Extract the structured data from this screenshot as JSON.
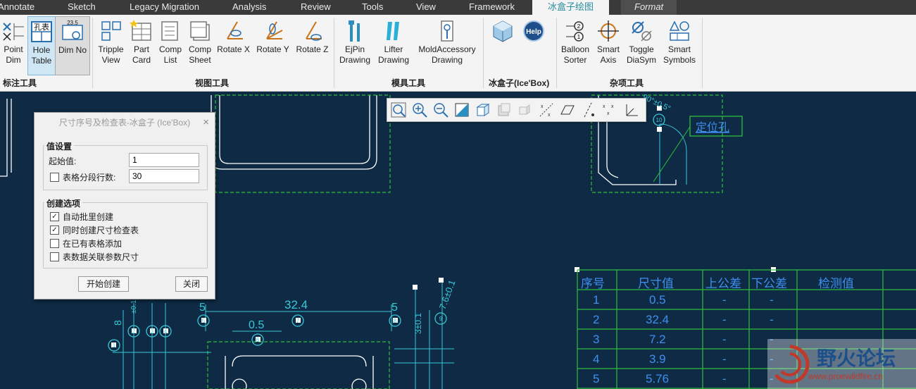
{
  "tabs": [
    {
      "label": "Annotate"
    },
    {
      "label": "Sketch"
    },
    {
      "label": "Legacy Migration"
    },
    {
      "label": "Analysis"
    },
    {
      "label": "Review"
    },
    {
      "label": "Tools"
    },
    {
      "label": "View"
    },
    {
      "label": "Framework"
    },
    {
      "label": "冰盒子绘图"
    },
    {
      "label": "Format"
    }
  ],
  "ribbon": {
    "buttons": [
      {
        "label": "Point\nDim"
      },
      {
        "label": "Hole\nTable"
      },
      {
        "label": "Dim No"
      },
      {
        "label": "Tripple\nView"
      },
      {
        "label": "Part\nCard"
      },
      {
        "label": "Comp\nList"
      },
      {
        "label": "Comp\nSheet"
      },
      {
        "label": "Rotate X"
      },
      {
        "label": "Rotate Y"
      },
      {
        "label": "Rotate Z"
      },
      {
        "label": "EjPin\nDrawing"
      },
      {
        "label": "Lifter\nDrawing"
      },
      {
        "label": "MoldAccessory\nDrawing"
      },
      {
        "label": ""
      },
      {
        "label": ""
      },
      {
        "label": "Balloon\nSorter"
      },
      {
        "label": "Smart\nAxis"
      },
      {
        "label": "Toggle\nDiaSym"
      },
      {
        "label": "Smart\nSymbols"
      }
    ],
    "icon_texts": {
      "hole_table": "孔表",
      "dim_no": "23.5"
    },
    "groups": [
      {
        "label": "标注工具"
      },
      {
        "label": "视图工具"
      },
      {
        "label": "模具工具"
      },
      {
        "label": "冰盒子(Ice'Box)"
      },
      {
        "label": "杂项工具"
      }
    ]
  },
  "dialog": {
    "title": "尺寸序号及检查表-冰盒子 (Ice'Box)",
    "close": "×",
    "values_group": {
      "legend": "值设置",
      "start_label": "起始值:",
      "start_value": "1",
      "rows_label": "表格分段行数:",
      "rows_value": "30",
      "rows_checked": false
    },
    "create_group": {
      "legend": "创建选项",
      "options": [
        {
          "label": "自动批里创建",
          "checked": true,
          "mark": "✓"
        },
        {
          "label": "同时创建尺寸检查表",
          "checked": true,
          "mark": "✓"
        },
        {
          "label": "在已有表格添加",
          "checked": false,
          "mark": ""
        },
        {
          "label": "表数据关联参数尺寸",
          "checked": false,
          "mark": ""
        }
      ]
    },
    "start_button": "开始创建",
    "close_button": "关闭"
  },
  "drawing": {
    "callout": "定位孔",
    "dims": {
      "d1": "32.4",
      "d2": "0.5",
      "d3": "5",
      "d4": "5",
      "d5": "±0.1",
      "d6": "8",
      "d7": "3±0.1",
      "d8": "7.6±0.1",
      "angle": "90°±0.5°"
    },
    "balloons": [
      "1",
      "2",
      "3",
      "4",
      "5",
      "6",
      "7",
      "8",
      "9",
      "10"
    ]
  },
  "table": {
    "headers": [
      "序号",
      "尺寸值",
      "上公差",
      "下公差",
      "检测值"
    ],
    "rows": [
      [
        "1",
        "0.5",
        "-",
        "-"
      ],
      [
        "2",
        "32.4",
        "-",
        "-"
      ],
      [
        "3",
        "7.2",
        "-",
        "-"
      ],
      [
        "4",
        "3.9",
        "-",
        "-"
      ],
      [
        "5",
        "5.76",
        "-",
        "-"
      ]
    ]
  },
  "watermark": {
    "title": "野火论坛",
    "url": "www.proewildfire.cn"
  },
  "colors": {
    "background": "#0e2a44",
    "drawing": "#38c8d8",
    "frame": "#2fbf3a",
    "table_text": "#3f8ff0"
  }
}
